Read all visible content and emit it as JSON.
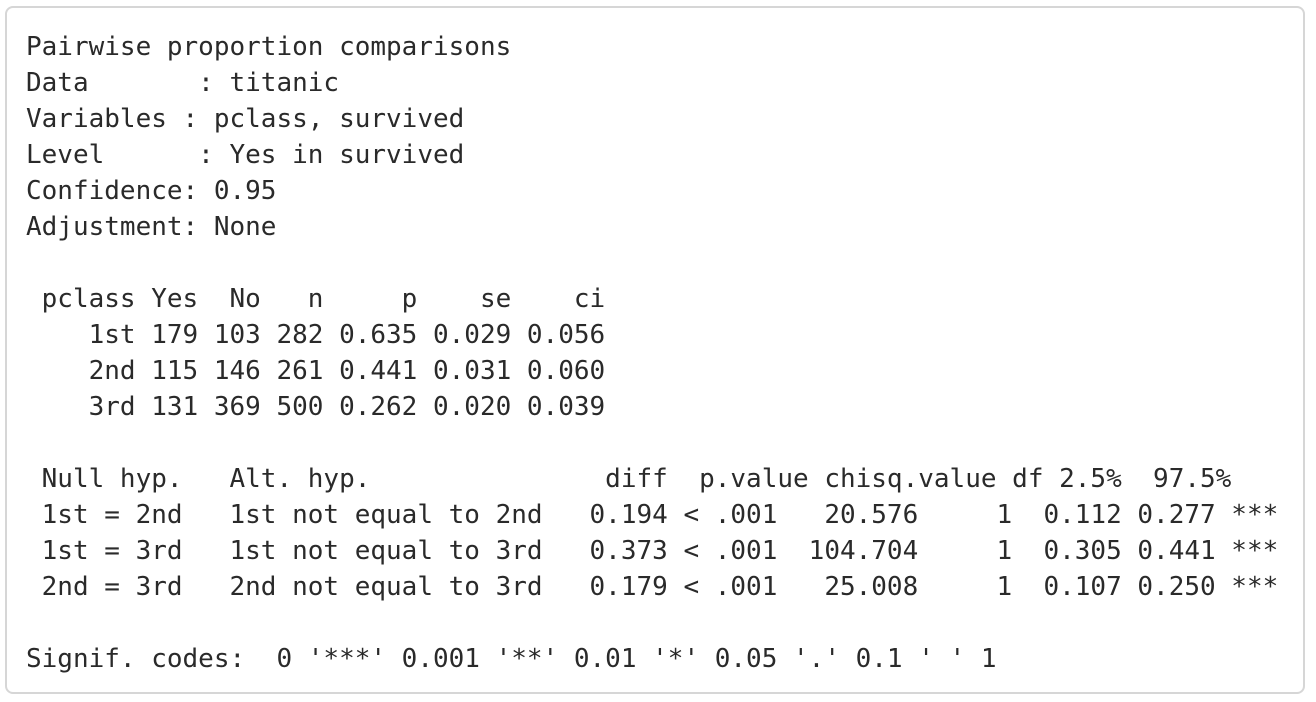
{
  "header": {
    "title": "Pairwise proportion comparisons",
    "data_line": "Data       : titanic",
    "variables_line": "Variables : pclass, survived",
    "level_line": "Level      : Yes in survived",
    "confidence_line": "Confidence: 0.95",
    "adjustment_line": "Adjustment: None"
  },
  "summary_table": {
    "header_line": " pclass Yes  No   n     p    se    ci",
    "rows": [
      "    1st 179 103 282 0.635 0.029 0.056",
      "    2nd 115 146 261 0.441 0.031 0.060",
      "    3rd 131 369 500 0.262 0.020 0.039"
    ]
  },
  "comparison_table": {
    "header_line": " Null hyp.   Alt. hyp.               diff  p.value chisq.value df 2.5%  97.5%",
    "rows": [
      " 1st = 2nd   1st not equal to 2nd   0.194 < .001   20.576     1  0.112 0.277 ***",
      " 1st = 3rd   1st not equal to 3rd   0.373 < .001  104.704     1  0.305 0.441 ***",
      " 2nd = 3rd   2nd not equal to 3rd   0.179 < .001   25.008     1  0.107 0.250 ***"
    ]
  },
  "footer": {
    "signif_codes": "Signif. codes:  0 '***' 0.001 '**' 0.01 '*' 0.05 '.' 0.1 ' ' 1"
  }
}
